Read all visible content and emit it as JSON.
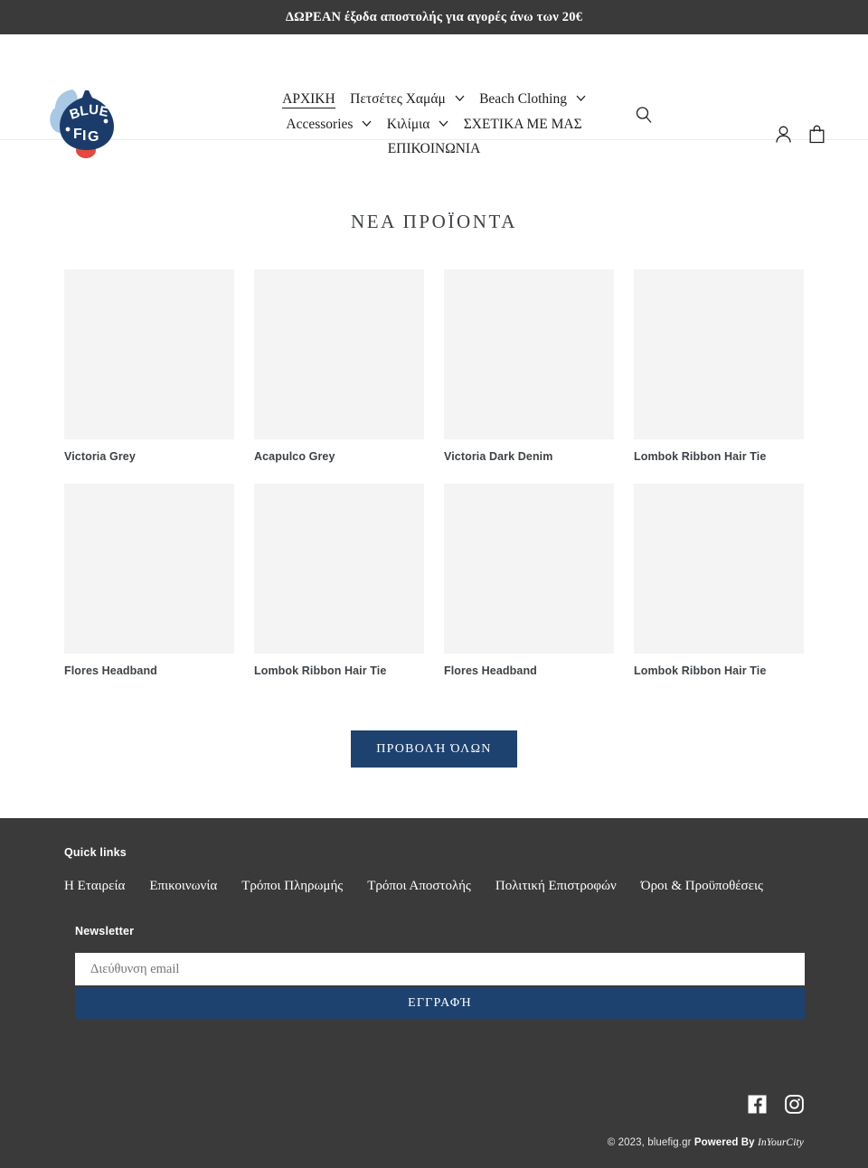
{
  "announcement": {
    "text": "ΔΩΡΕΑΝ έξοδα αποστολής για αγορές άνω των 20€"
  },
  "header": {
    "logo_alt": "BLUE FIG",
    "logo_line1": "BLUE",
    "logo_line2": "FIG",
    "nav": [
      {
        "label": "ΑΡΧΙΚΗ",
        "has_dropdown": false,
        "active": true
      },
      {
        "label": "Πετσέτες Χαμάμ",
        "has_dropdown": true,
        "active": false
      },
      {
        "label": "Beach Clothing",
        "has_dropdown": true,
        "active": false
      },
      {
        "label": "Accessories",
        "has_dropdown": true,
        "active": false
      },
      {
        "label": "Κιλίμια",
        "has_dropdown": true,
        "active": false
      },
      {
        "label": "ΣΧΕΤΙΚΑ ΜΕ ΜΑΣ",
        "has_dropdown": false,
        "active": false
      },
      {
        "label": "ΕΠΙΚΟΙΝΩΝΙΑ",
        "has_dropdown": false,
        "active": false
      }
    ],
    "icons": {
      "search": "search-icon",
      "account": "account-icon",
      "cart": "cart-icon"
    }
  },
  "main": {
    "section_title": "ΝΕΑ ΠΡΟΪΟΝΤΑ",
    "products": [
      {
        "title": "Victoria Grey"
      },
      {
        "title": "Acapulco Grey"
      },
      {
        "title": "Victoria Dark Denim"
      },
      {
        "title": "Lombok Ribbon Hair Tie"
      },
      {
        "title": "Flores Headband"
      },
      {
        "title": "Lombok Ribbon Hair Tie"
      },
      {
        "title": "Flores Headband"
      },
      {
        "title": "Lombok Ribbon Hair Tie"
      }
    ],
    "view_all_label": "ΠΡΟΒΟΛΉ ΌΛΩΝ"
  },
  "footer": {
    "quick_links_heading": "Quick links",
    "quick_links": [
      "Η Εταιρεία",
      "Επικοινωνία",
      "Τρόποι Πληρωμής",
      "Τρόποι Αποστολής",
      "Πολιτική Επιστροφών",
      "Όροι & Προϋποθέσεις"
    ],
    "newsletter_heading": "Newsletter",
    "newsletter_placeholder": "Διεύθυνση email",
    "newsletter_value": "",
    "newsletter_button": "ΕΓΓΡΑΦΉ",
    "social": [
      {
        "name": "facebook-icon"
      },
      {
        "name": "instagram-icon"
      }
    ],
    "copyright": "© 2023, bluefig.gr",
    "powered_by": "Powered By",
    "powered_brand": "InYourCity"
  },
  "colors": {
    "accent_navy": "#1d4270",
    "dark_bar": "#3a3a3a",
    "placeholder_grey": "#f4f4f4",
    "logo_blue": "#1b3c6b",
    "logo_leaf": "#a8c8e4",
    "logo_red": "#e4483f"
  }
}
